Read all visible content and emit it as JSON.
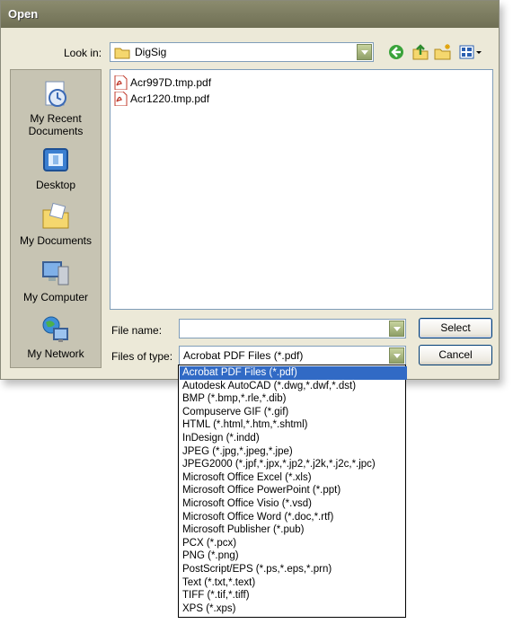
{
  "dialog": {
    "title": "Open"
  },
  "lookin": {
    "label": "Look in:",
    "value": "DigSig"
  },
  "toolbar": {
    "icons": [
      "back-icon",
      "up-folder-icon",
      "new-folder-icon",
      "view-menu-icon"
    ]
  },
  "places": [
    {
      "label": "My Recent Documents",
      "icon": "recent-documents-icon"
    },
    {
      "label": "Desktop",
      "icon": "desktop-icon"
    },
    {
      "label": "My Documents",
      "icon": "my-documents-icon"
    },
    {
      "label": "My Computer",
      "icon": "my-computer-icon"
    },
    {
      "label": "My Network",
      "icon": "my-network-icon"
    }
  ],
  "files": [
    {
      "name": "Acr997D.tmp.pdf",
      "icon": "pdf-file-icon"
    },
    {
      "name": "Acr1220.tmp.pdf",
      "icon": "pdf-file-icon"
    }
  ],
  "filename": {
    "label": "File name:",
    "value": ""
  },
  "filetype": {
    "label": "Files of type:",
    "value": "Acrobat PDF Files (*.pdf)",
    "options": [
      "Acrobat PDF Files (*.pdf)",
      "Autodesk AutoCAD (*.dwg,*.dwf,*.dst)",
      "BMP (*.bmp,*.rle,*.dib)",
      "Compuserve GIF (*.gif)",
      "HTML (*.html,*.htm,*.shtml)",
      "InDesign (*.indd)",
      "JPEG (*.jpg,*.jpeg,*.jpe)",
      "JPEG2000 (*.jpf,*.jpx,*.jp2,*.j2k,*.j2c,*.jpc)",
      "Microsoft Office Excel (*.xls)",
      "Microsoft Office PowerPoint (*.ppt)",
      "Microsoft Office Visio (*.vsd)",
      "Microsoft Office Word (*.doc,*.rtf)",
      "Microsoft Publisher (*.pub)",
      "PCX (*.pcx)",
      "PNG (*.png)",
      "PostScript/EPS (*.ps,*.eps,*.prn)",
      "Text (*.txt,*.text)",
      "TIFF (*.tif,*.tiff)",
      "XPS (*.xps)"
    ],
    "selected_index": 0
  },
  "buttons": {
    "select": "Select",
    "cancel": "Cancel"
  },
  "colors": {
    "selection": "#316ac5",
    "dialog_bg": "#ece9d8",
    "titlebar": "#7d7d62"
  }
}
